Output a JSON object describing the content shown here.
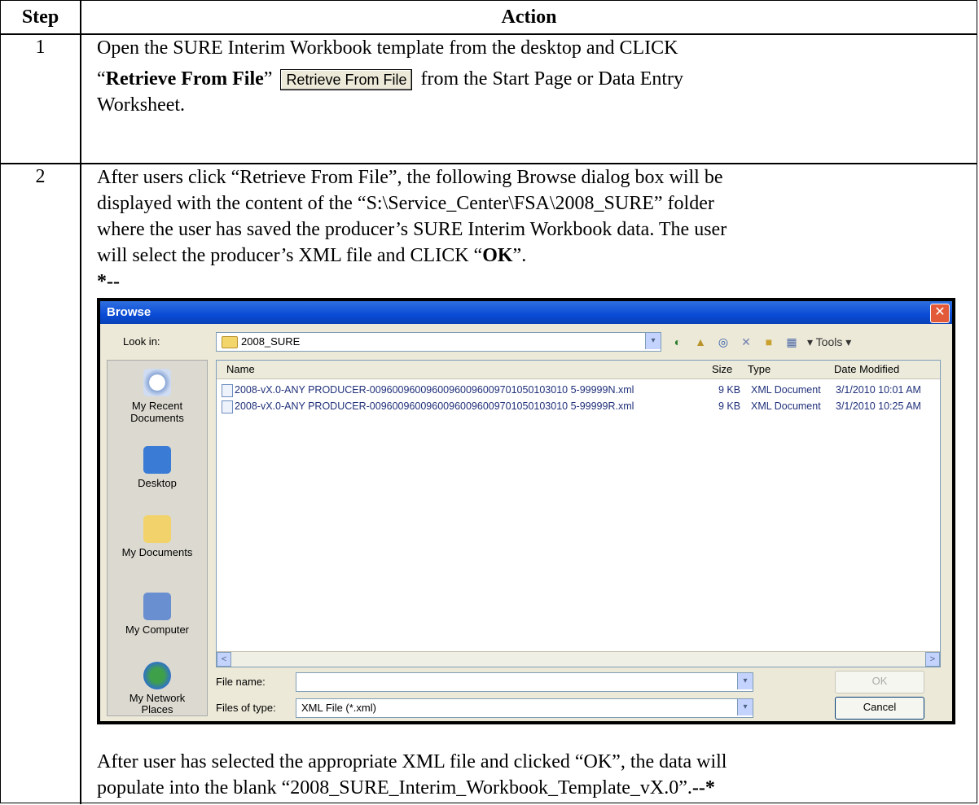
{
  "table": {
    "header_step": "Step",
    "header_action": "Action",
    "rows": [
      {
        "step": "1",
        "line1": "Open the SURE Interim Workbook template from the desktop and CLICK",
        "line2_prefix": "“",
        "line2_bold": "Retrieve From File",
        "line2_after": "”",
        "button_label": "Retrieve From File",
        "line2_suffix": "from the Start Page or Data Entry",
        "line3": "Worksheet."
      },
      {
        "step": "2",
        "para1_l1": "After users click “Retrieve From File”, the following Browse dialog box will be",
        "para1_l2": "displayed with the content of the “S:\\Service_Center\\FSA\\2008_SURE” folder",
        "para1_l3": "where the user has saved the producer’s SURE Interim Workbook data.  The user",
        "para1_l4_prefix": "will select the producer’s XML file and CLICK “",
        "para1_l4_bold": "OK",
        "para1_l4_suffix": "”.",
        "marker_start": "*--",
        "para2_l1": "After user has selected the appropriate XML file and clicked “OK”, the data will",
        "para2_l2": "populate into the blank “2008_SURE_Interim_Workbook_Template_vX.0”.",
        "marker_end": "--*"
      }
    ]
  },
  "dialog": {
    "title": "Browse",
    "close_glyph": "✕",
    "look_in_label": "Look in:",
    "look_in_value": "2008_SURE",
    "tools_label": "▾ Tools ▾",
    "columns": [
      "Name",
      "Size",
      "Type",
      "Date Modified"
    ],
    "files": [
      {
        "name": "2008-vX.0-ANY PRODUCER-00960096009600960096009701050103010 5-99999N.xml",
        "size": "9 KB",
        "type": "XML Document",
        "date": "3/1/2010 10:01 AM"
      },
      {
        "name": "2008-vX.0-ANY PRODUCER-00960096009600960096009701050103010 5-99999R.xml",
        "size": "9 KB",
        "type": "XML Document",
        "date": "3/1/2010 10:25 AM"
      }
    ],
    "places": [
      "My Recent Documents",
      "Desktop",
      "My Documents",
      "My Computer",
      "My Network Places"
    ],
    "file_name_label": "File name:",
    "file_name_value": "",
    "files_of_type_label": "Files of type:",
    "files_of_type_value": "XML File (*.xml)",
    "ok_label": "OK",
    "cancel_label": "Cancel",
    "scroll_left": "<",
    "scroll_right": ">",
    "dropdown_arrow": "▾"
  }
}
